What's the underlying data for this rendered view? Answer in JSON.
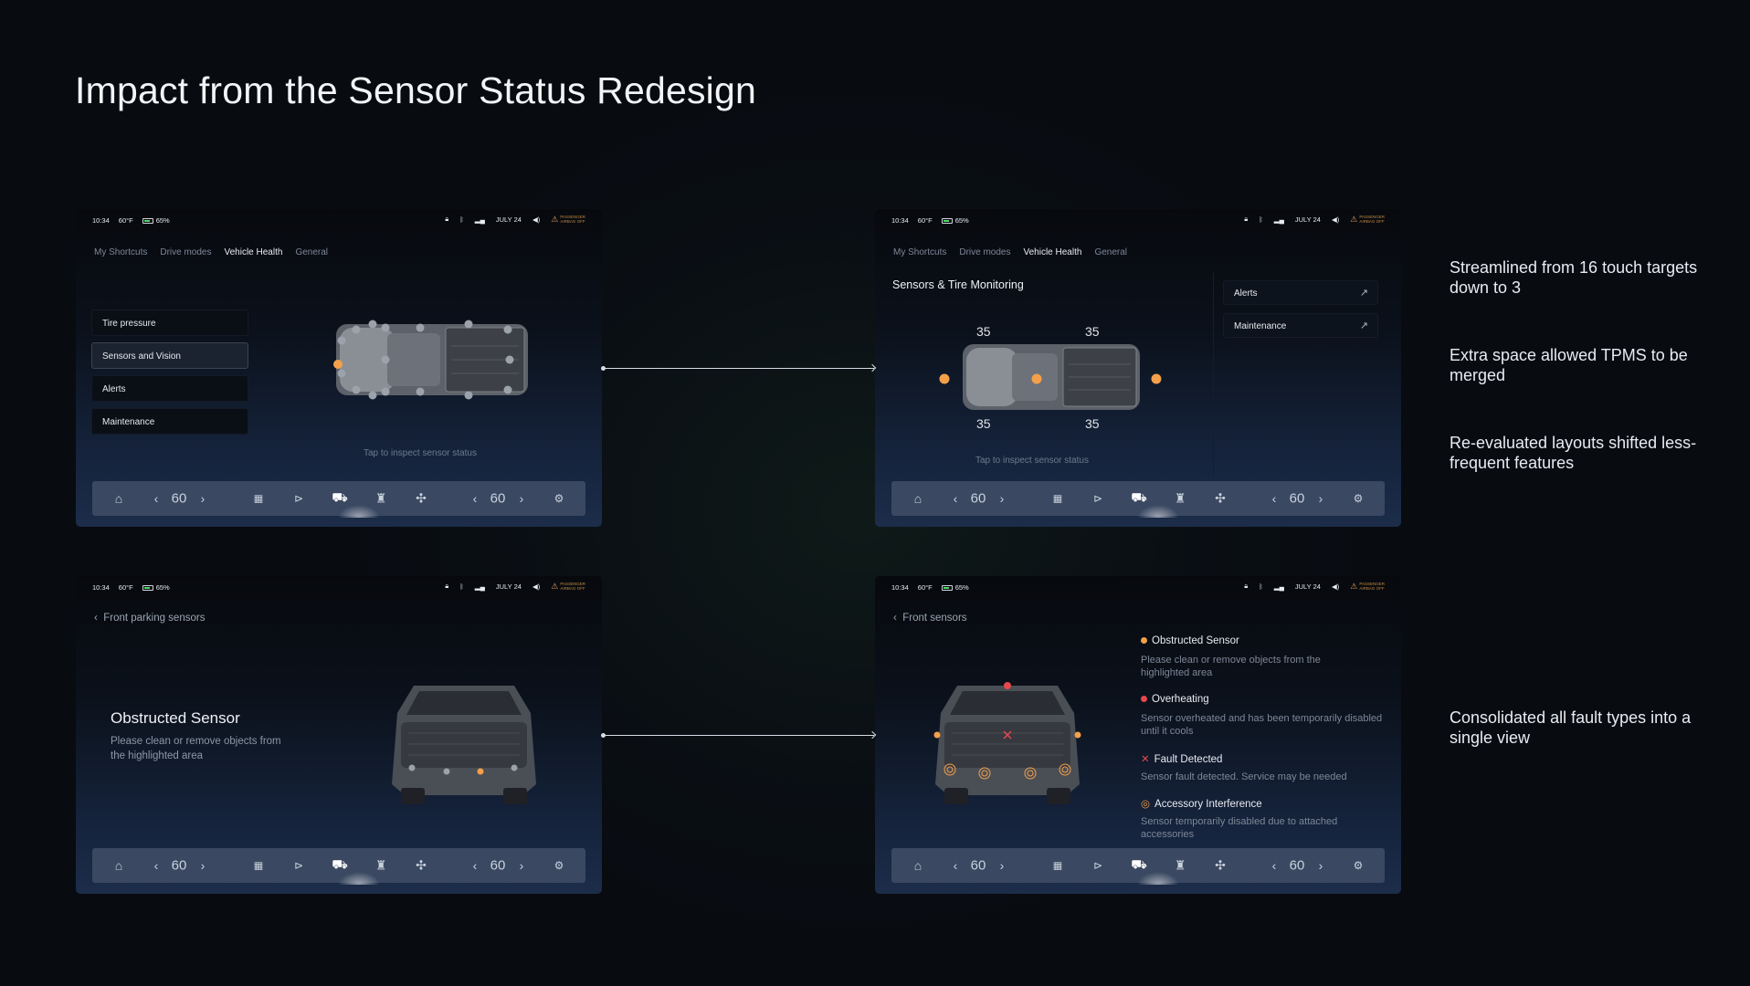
{
  "title": "Impact from the Sensor Status Redesign",
  "status_bar": {
    "time": "10:34",
    "temp": "60°F",
    "battery": "65%",
    "date": "JULY 24",
    "passenger_airbag_line1": "PASSENGER",
    "passenger_airbag_line2": "AIRBAG OFF"
  },
  "tabs": [
    "My Shortcuts",
    "Drive modes",
    "Vehicle Health",
    "General"
  ],
  "nav": {
    "left_value": "60",
    "right_value": "60"
  },
  "screen1": {
    "menu": [
      "Tire pressure",
      "Sensors and Vision",
      "Alerts",
      "Maintenance"
    ],
    "hint": "Tap to inspect sensor status"
  },
  "screen2": {
    "section_title": "Sensors & Tire Monitoring",
    "tire_pressures": [
      "35",
      "35",
      "35",
      "35"
    ],
    "hint": "Tap to inspect sensor status",
    "links": [
      "Alerts",
      "Maintenance"
    ]
  },
  "screen3": {
    "back_label": "Front parking sensors",
    "status_title": "Obstructed Sensor",
    "status_desc": "Please clean or remove objects from the highlighted area"
  },
  "screen4": {
    "back_label": "Front sensors",
    "faults": [
      {
        "title": "Obstructed Sensor",
        "desc": "Please clean or remove objects from the highlighted area",
        "color": "#f4a04a"
      },
      {
        "title": "Overheating",
        "desc": "Sensor overheated and has been temporarily disabled until it cools",
        "color": "#e5484d"
      },
      {
        "title": "Fault Detected",
        "desc": "Sensor fault detected. Service may be needed",
        "color": "#e5484d"
      },
      {
        "title": "Accessory Interference",
        "desc": "Sensor temporarily disabled due to attached accessories",
        "color": "#f4a04a"
      }
    ]
  },
  "notes": [
    "Streamlined from 16 touch targets down to 3",
    "Extra space allowed TPMS to be merged",
    "Re-evaluated layouts shifted less-frequent features",
    "Consolidated all fault types into a single view"
  ],
  "colors": {
    "accent_orange": "#f4a04a",
    "alert_red": "#e5484d",
    "nav_bg": "#3a4861"
  },
  "icons": {
    "nav": [
      "home-icon",
      "chevron-left-icon",
      "chevron-right-icon",
      "grid-icon",
      "play-icon",
      "car-icon",
      "seat-icon",
      "fan-icon",
      "chevron-left-icon",
      "chevron-right-icon",
      "gear-icon"
    ],
    "status": [
      "lock-icon",
      "bluetooth-icon",
      "signal-icon",
      "volume-icon",
      "airbag-icon"
    ]
  }
}
